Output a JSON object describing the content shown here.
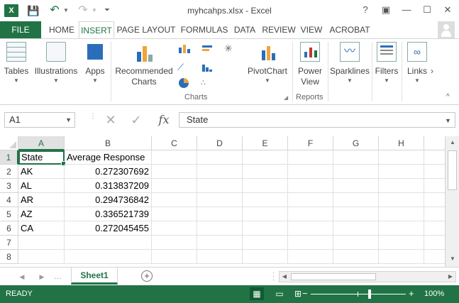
{
  "window": {
    "title": "myhcahps.xlsx - Excel",
    "logo": "X",
    "help": "?",
    "restore": "▣",
    "minimize": "—",
    "maximize": "☐",
    "close": "✕"
  },
  "quick_access": {
    "save_icon": "💾",
    "undo_icon": "↶",
    "redo_icon": "↷",
    "customize_icon": "⏷"
  },
  "ribbon_tabs": {
    "file": "FILE",
    "items": [
      "HOME",
      "INSERT",
      "PAGE LAYOUT",
      "FORMULAS",
      "DATA",
      "REVIEW",
      "VIEW",
      "ACROBAT"
    ],
    "active": "INSERT"
  },
  "ribbon": {
    "tables": "Tables",
    "illustrations": "Illustrations",
    "apps": "Apps",
    "recommended_charts_line1": "Recommended",
    "recommended_charts_line2": "Charts",
    "pivotchart": "PivotChart",
    "power_view_line1": "Power",
    "power_view_line2": "View",
    "sparklines": "Sparklines",
    "filters": "Filters",
    "links": "Links",
    "group_charts": "Charts",
    "group_reports": "Reports",
    "more": "›",
    "collapse": "^"
  },
  "formula_bar": {
    "name_box": "A1",
    "cancel_icon": "✕",
    "enter_icon": "✓",
    "fx": "fx",
    "formula": "State"
  },
  "grid": {
    "columns": [
      "A",
      "B",
      "C",
      "D",
      "E",
      "F",
      "G",
      "H"
    ],
    "rows": [
      "1",
      "2",
      "3",
      "4",
      "5",
      "6",
      "7",
      "8"
    ],
    "cells": [
      {
        "a": "State",
        "b": "Average Response"
      },
      {
        "a": "AK",
        "b": "0.272307692"
      },
      {
        "a": "AL",
        "b": "0.313837209"
      },
      {
        "a": "AR",
        "b": "0.294736842"
      },
      {
        "a": "AZ",
        "b": "0.336521739"
      },
      {
        "a": "CA",
        "b": "0.272045455"
      }
    ]
  },
  "sheets": {
    "tabs": [
      "Sheet1"
    ],
    "add": "+"
  },
  "status": {
    "text": "READY",
    "zoom_minus": "−",
    "zoom_plus": "+",
    "zoom": "100%"
  }
}
